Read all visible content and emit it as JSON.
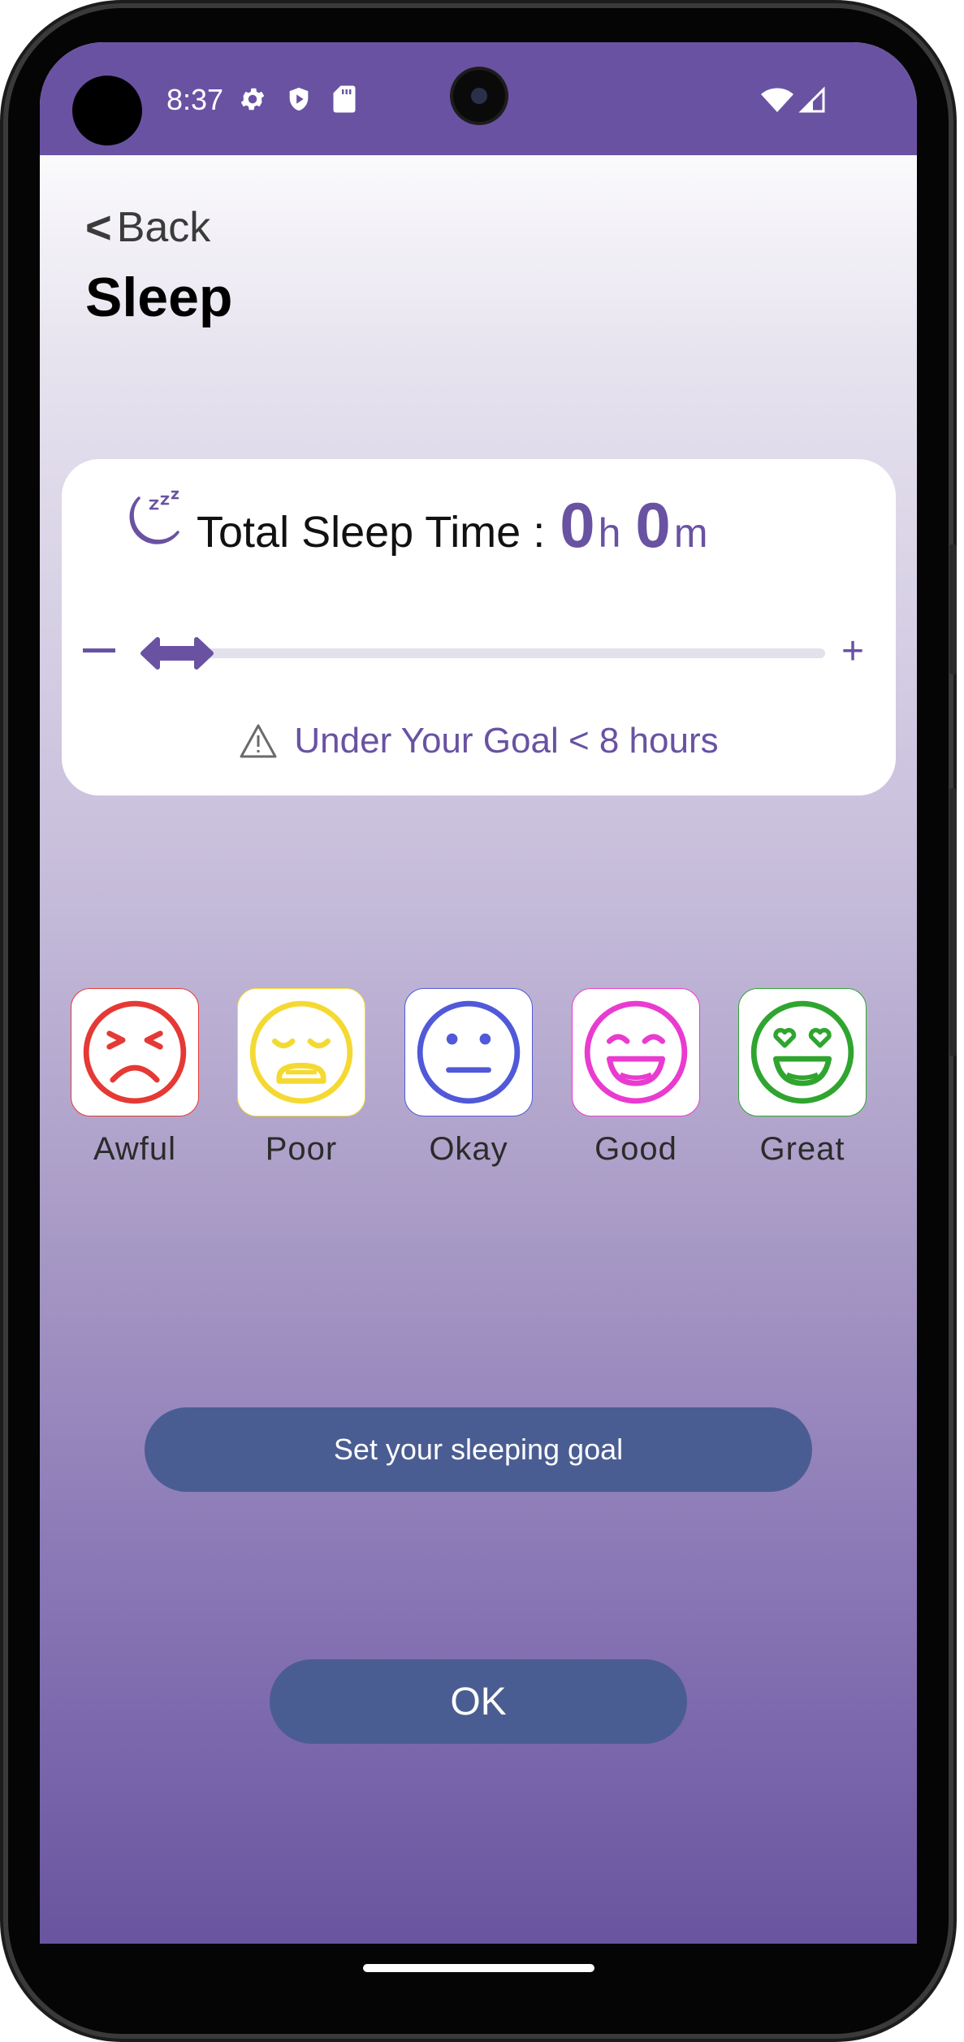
{
  "status_bar": {
    "time": "8:37"
  },
  "header": {
    "back_label": "Back",
    "back_chevron": "<",
    "title": "Sleep"
  },
  "sleep_card": {
    "label": "Total Sleep Time :",
    "hours": "0",
    "hours_unit": "h",
    "minutes": "0",
    "minutes_unit": "m",
    "slider_value": 0,
    "plus_label": "+",
    "warning": "Under Your Goal < 8 hours"
  },
  "moods": [
    {
      "label": "Awful",
      "color": "#e53935",
      "icon": "awful-face-icon"
    },
    {
      "label": "Poor",
      "color": "#f5d933",
      "icon": "poor-face-icon"
    },
    {
      "label": "Okay",
      "color": "#5159d9",
      "icon": "okay-face-icon"
    },
    {
      "label": "Good",
      "color": "#ea3bd0",
      "icon": "good-face-icon"
    },
    {
      "label": "Great",
      "color": "#2fa52f",
      "icon": "great-face-icon"
    }
  ],
  "buttons": {
    "goal": "Set your sleeping goal",
    "ok": "OK"
  },
  "colors": {
    "accent": "#6952a2",
    "button": "#4a5d92",
    "status_bar": "#6952a2"
  }
}
